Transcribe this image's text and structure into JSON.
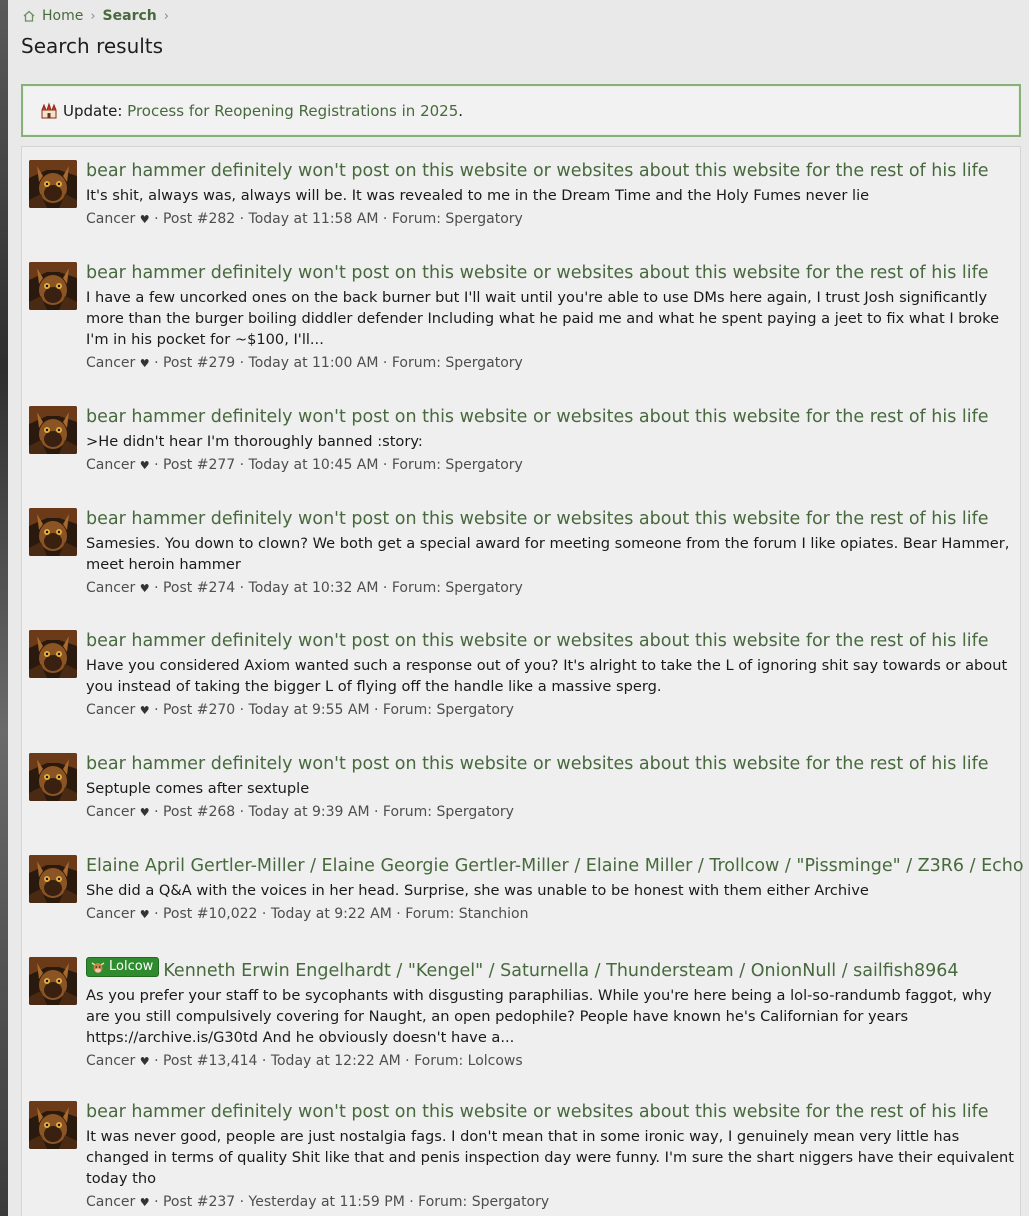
{
  "breadcrumb": {
    "home": "Home",
    "search": "Search",
    "sep": "›"
  },
  "page_title": "Search results",
  "notice": {
    "prefix": "Update: ",
    "link": "Process for Reopening Registrations in 2025",
    "suffix": "."
  },
  "results": [
    {
      "title": "bear hammer definitely won't post on this website or websites about this website for the rest of his life",
      "snippet": "It's shit, always was, always will be. It was revealed to me in the Dream Time and the Holy Fumes never lie",
      "author": "Cancer",
      "post": "Post #282",
      "time": "Today at 11:58 AM",
      "forum": "Forum: Spergatory"
    },
    {
      "title": "bear hammer definitely won't post on this website or websites about this website for the rest of his life",
      "snippet": "I have a few uncorked ones on the back burner but I'll wait until you're able to use DMs here again, I trust Josh significantly more than the burger boiling diddler defender Including what he paid me and what he spent paying a jeet to fix what I broke I'm in his pocket for ~$100, I'll...",
      "author": "Cancer",
      "post": "Post #279",
      "time": "Today at 11:00 AM",
      "forum": "Forum: Spergatory"
    },
    {
      "title": "bear hammer definitely won't post on this website or websites about this website for the rest of his life",
      "snippet": ">He didn't hear I'm thoroughly banned :story:",
      "author": "Cancer",
      "post": "Post #277",
      "time": "Today at 10:45 AM",
      "forum": "Forum: Spergatory"
    },
    {
      "title": "bear hammer definitely won't post on this website or websites about this website for the rest of his life",
      "snippet": "Samesies. You down to clown? We both get a special award for meeting someone from the forum I like opiates. Bear Hammer, meet heroin hammer",
      "author": "Cancer",
      "post": "Post #274",
      "time": "Today at 10:32 AM",
      "forum": "Forum: Spergatory"
    },
    {
      "title": "bear hammer definitely won't post on this website or websites about this website for the rest of his life",
      "snippet": "Have you considered Axiom wanted such a response out of you? It's alright to take the L of ignoring shit say towards or about you instead of taking the bigger L of flying off the handle like a massive sperg.",
      "author": "Cancer",
      "post": "Post #270",
      "time": "Today at 9:55 AM",
      "forum": "Forum: Spergatory"
    },
    {
      "title": "bear hammer definitely won't post on this website or websites about this website for the rest of his life",
      "snippet": "Septuple comes after sextuple",
      "author": "Cancer",
      "post": "Post #268",
      "time": "Today at 9:39 AM",
      "forum": "Forum: Spergatory"
    },
    {
      "title": "Elaine April Gertler-Miller / Elaine Georgie Gertler-Miller / Elaine Miller / Trollcow / \"Pissminge\" / Z3R6 / Echo",
      "snippet": "She did a Q&A with the voices in her head. Surprise, she was unable to be honest with them either Archive",
      "author": "Cancer",
      "post": "Post #10,022",
      "time": "Today at 9:22 AM",
      "forum": "Forum: Stanchion"
    },
    {
      "badge": "Lolcow",
      "title": "Kenneth Erwin Engelhardt / \"Kengel\" / Saturnella / Thundersteam / OnionNull / sailfish8964",
      "snippet": "As you prefer your staff to be sycophants with disgusting paraphilias. While you're here being a lol-so-randumb faggot, why are you still compulsively covering for Naught, an open pedophile? People have known he's Californian for years https://archive.is/G30td And he obviously doesn't have a...",
      "author": "Cancer",
      "post": "Post #13,414",
      "time": "Today at 12:22 AM",
      "forum": "Forum: Lolcows"
    },
    {
      "title": "bear hammer definitely won't post on this website or websites about this website for the rest of his life",
      "snippet": "It was never good, people are just nostalgia fags. I don't mean that in some ironic way, I genuinely mean very little has changed in terms of quality Shit like that and penis inspection day were funny. I'm sure the shart niggers have their equivalent today tho",
      "author": "Cancer",
      "post": "Post #237",
      "time": "Yesterday at 11:59 PM",
      "forum": "Forum: Spergatory"
    }
  ],
  "meta_sep": " · ",
  "heart": "♥",
  "colors": {
    "link_green": "#47693d",
    "notice_border": "#88b07a",
    "badge_green": "#2e8b2e"
  }
}
